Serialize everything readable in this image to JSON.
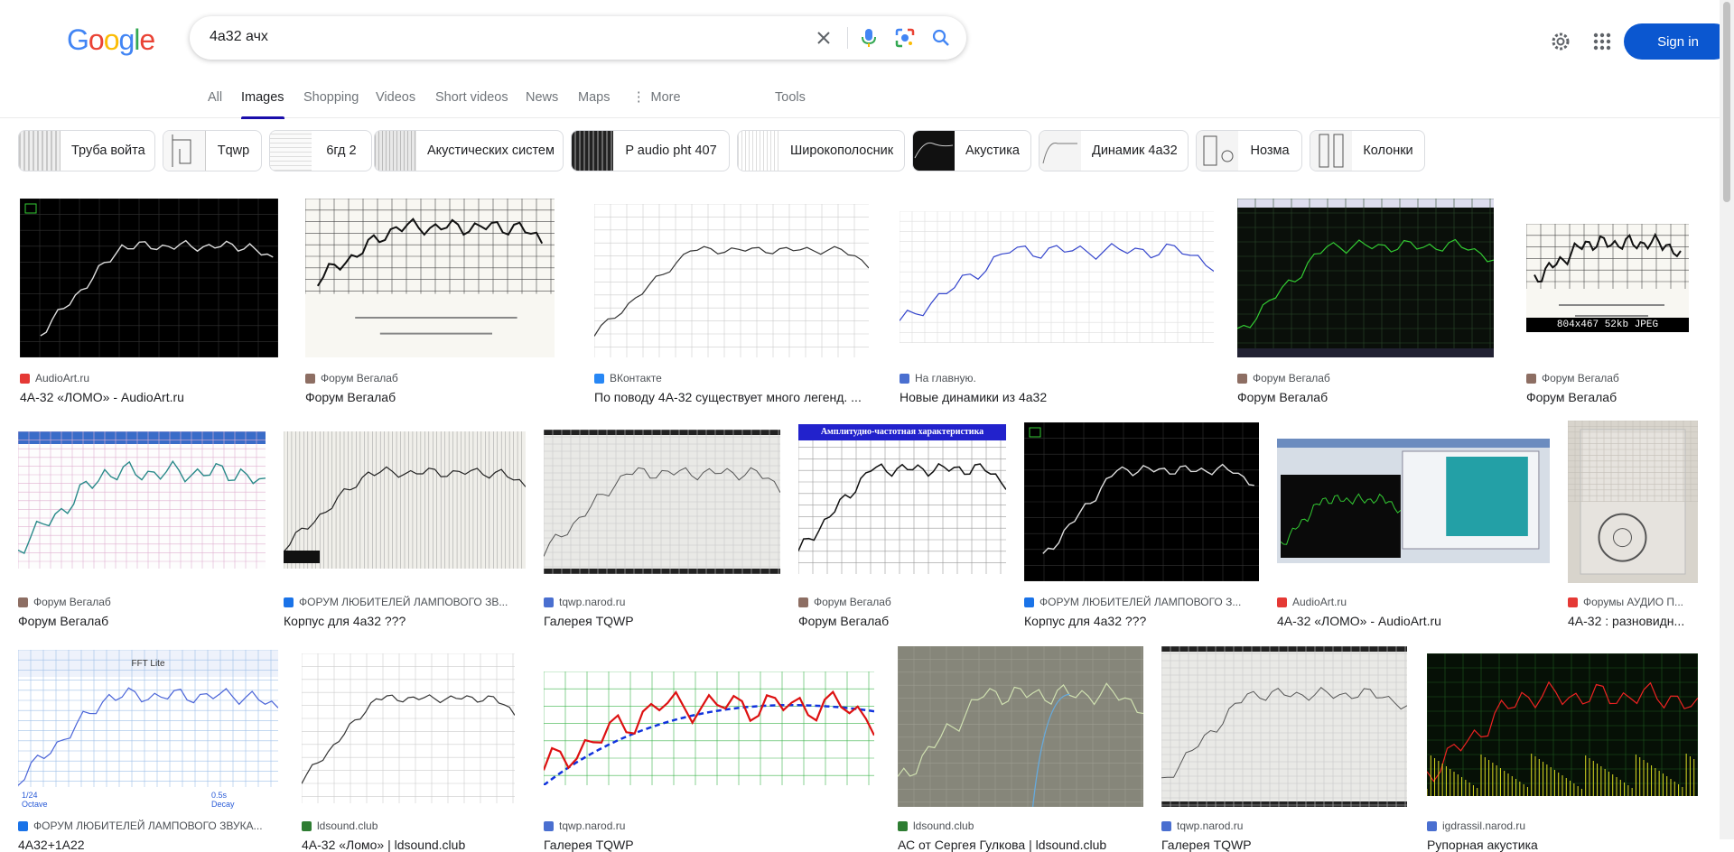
{
  "logo": {
    "letters": [
      "G",
      "o",
      "o",
      "g",
      "l",
      "e"
    ],
    "colors": [
      "#4285f4",
      "#ea4335",
      "#fbbc05",
      "#4285f4",
      "#34a853",
      "#ea4335"
    ]
  },
  "search": {
    "query": "4а32 ачх"
  },
  "header": {
    "signin_label": "Sign in"
  },
  "tabs": [
    {
      "label": "All"
    },
    {
      "label": "Images"
    },
    {
      "label": "Shopping"
    },
    {
      "label": "Videos"
    },
    {
      "label": "Short videos"
    },
    {
      "label": "News"
    },
    {
      "label": "Maps"
    },
    {
      "label": "More"
    },
    {
      "label": "Tools"
    }
  ],
  "chips": [
    {
      "label": "Труба войта"
    },
    {
      "label": "Tqwp"
    },
    {
      "label": "6гд 2"
    },
    {
      "label": "Акустических систем"
    },
    {
      "label": "P audio pht 407"
    },
    {
      "label": "Широкополосник"
    },
    {
      "label": "Акустика"
    },
    {
      "label": "Динамик 4а32"
    },
    {
      "label": "Нозма"
    },
    {
      "label": "Колонки"
    }
  ],
  "results": [
    {
      "source": "AudioArt.ru",
      "title": "4А-32 «ЛОМО» - AudioArt.ru",
      "fav": "#e53935"
    },
    {
      "source": "Форум Вегалаб",
      "title": "Форум Вегалаб",
      "fav": "#8d6e63"
    },
    {
      "source": "ВКонтакте",
      "title": "По поводу 4А-32 существует много легенд. ...",
      "fav": "#2787f5"
    },
    {
      "source": "На главную.",
      "title": "Новые динамики из 4а32",
      "fav": "#4a6fd0"
    },
    {
      "source": "Форум Вегалаб",
      "title": "Форум Вегалаб",
      "fav": "#8d6e63"
    },
    {
      "source": "Форум Вегалаб",
      "title": "Форум Вегалаб",
      "fav": "#8d6e63",
      "caption": "804x467 52kb JPEG"
    },
    {
      "source": "Форум Вегалаб",
      "title": "Форум Вегалаб",
      "fav": "#8d6e63"
    },
    {
      "source": "ФОРУМ ЛЮБИТЕЛЕЙ ЛАМПОВОГО ЗВ...",
      "title": "Корпус для 4а32 ???",
      "fav": "#1a73e8"
    },
    {
      "source": "tqwp.narod.ru",
      "title": "Галерея TQWP",
      "fav": "#4a6fd0"
    },
    {
      "source": "Форум Вегалаб",
      "title": "Форум Вегалаб",
      "fav": "#8d6e63",
      "header": "Амплитудно-частотная характеристика"
    },
    {
      "source": "ФОРУМ ЛЮБИТЕЛЕЙ ЛАМПОВОГО З...",
      "title": "Корпус для 4а32 ???",
      "fav": "#1a73e8"
    },
    {
      "source": "AudioArt.ru",
      "title": "4А-32 «ЛОМО» - AudioArt.ru",
      "fav": "#e53935"
    },
    {
      "source": "Форумы АУДИО П...",
      "title": "4А-32 : разновидн...",
      "fav": "#e53935"
    },
    {
      "source": "ФОРУМ ЛЮБИТЕЛЕЙ ЛАМПОВОГО ЗВУКА...",
      "title": "4А32+1А22",
      "fav": "#1a73e8",
      "app_title": "FFT Lite",
      "footer_left": "1/24 Octave",
      "footer_right": "0.5s Decay"
    },
    {
      "source": "ldsound.club",
      "title": "4А-32 «Ломо» | ldsound.club",
      "fav": "#2e7d32"
    },
    {
      "source": "tqwp.narod.ru",
      "title": "Галерея TQWP",
      "fav": "#4a6fd0"
    },
    {
      "source": "ldsound.club",
      "title": "АС от Сергея Гулкова | ldsound.club",
      "fav": "#2e7d32"
    },
    {
      "source": "tqwp.narod.ru",
      "title": "Галерея TQWP",
      "fav": "#4a6fd0"
    },
    {
      "source": "igdrassil.narod.ru",
      "title": "Рупорная акустика",
      "fav": "#4a6fd0"
    }
  ]
}
